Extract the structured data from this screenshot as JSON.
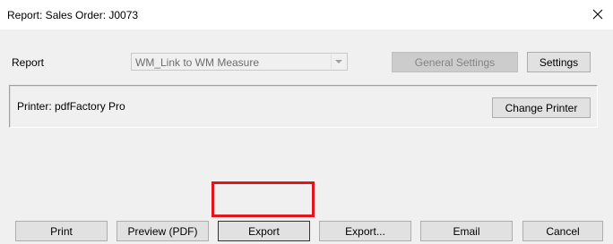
{
  "window": {
    "title": "Report: Sales Order: J0073",
    "close_glyph": "✕"
  },
  "form": {
    "report_label": "Report",
    "report_select_value": "WM_Link to WM Measure",
    "general_settings_label": "General Settings",
    "settings_label": "Settings"
  },
  "printer_panel": {
    "printer_text": "Printer: pdfFactory Pro",
    "change_printer_label": "Change Printer"
  },
  "actions": {
    "print": "Print",
    "preview_pdf": "Preview (PDF)",
    "export": "Export",
    "export_dialog": "Export...",
    "email": "Email",
    "cancel": "Cancel"
  },
  "colors": {
    "highlight": "#e0161c"
  },
  "icons": [
    "close-icon",
    "dropdown-arrow-icon"
  ]
}
